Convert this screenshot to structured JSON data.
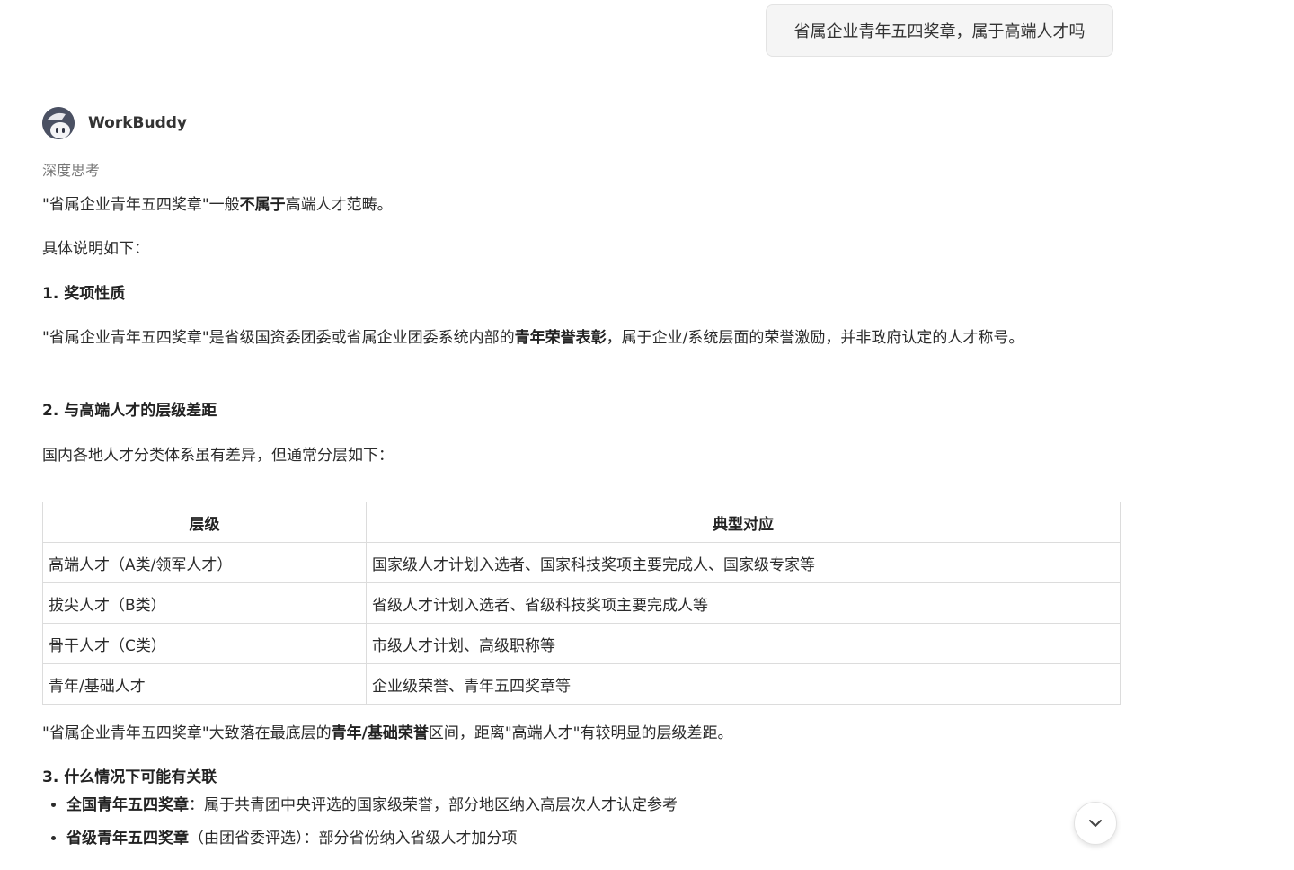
{
  "user_message": "省属企业青年五四奖章，属于高端人才吗",
  "assistant": {
    "name": "WorkBuddy",
    "thinking_label": "深度思考"
  },
  "answer": {
    "intro_part1": "\"省属企业青年五四奖章\"一般",
    "intro_bold": "不属于",
    "intro_part2": "高端人才范畴。",
    "detail_label": "具体说明如下：",
    "section1_title": "1. 奖项性质",
    "section1_part1": "\"省属企业青年五四奖章\"是省级国资委团委或省属企业团委系统内部的",
    "section1_bold": "青年荣誉表彰",
    "section1_part2": "，属于企业/系统层面的荣誉激励，并非政府认定的人才称号。",
    "section2_title": "2. 与高端人才的层级差距",
    "section2_text": "国内各地人才分类体系虽有差异，但通常分层如下：",
    "table": {
      "headers": [
        "层级",
        "典型对应"
      ],
      "rows": [
        [
          "高端人才（A类/领军人才）",
          "国家级人才计划入选者、国家科技奖项主要完成人、国家级专家等"
        ],
        [
          "拔尖人才（B类）",
          "省级人才计划入选者、省级科技奖项主要完成人等"
        ],
        [
          "骨干人才（C类）",
          "市级人才计划、高级职称等"
        ],
        [
          "青年/基础人才",
          "企业级荣誉、青年五四奖章等"
        ]
      ]
    },
    "summary_part1": "\"省属企业青年五四奖章\"大致落在最底层的",
    "summary_bold": "青年/基础荣誉",
    "summary_part2": "区间，距离\"高端人才\"有较明显的层级差距。",
    "section3_title": "3. 什么情况下可能有关联",
    "bullets": [
      {
        "bold": "全国青年五四奖章",
        "text": "：属于共青团中央评选的国家级荣誉，部分地区纳入高层次人才认定参考"
      },
      {
        "bold": "省级青年五四奖章",
        "text": "（由团省委评选）：部分省份纳入省级人才加分项"
      }
    ]
  }
}
